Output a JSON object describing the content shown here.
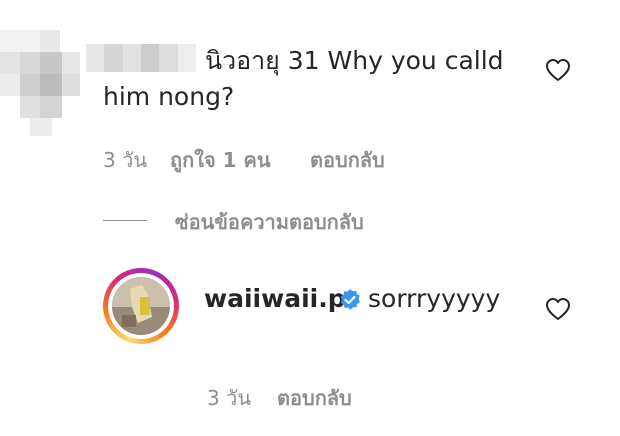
{
  "comment": {
    "text_line1": "นิวอายุ 31 Why you calld",
    "text_line2": "him nong?",
    "time": "3 วัน",
    "likes": "ถูกใจ 1 คน",
    "reply_label": "ตอบกลับ",
    "like_icon": "heart-icon"
  },
  "thread": {
    "hide_replies_label": "ซ่อนข้อความตอบกลับ"
  },
  "reply": {
    "username": "waiiwaii.p",
    "verified_icon": "verified-badge-icon",
    "text": "sorrryyyyy",
    "time": "3 วัน",
    "reply_label": "ตอบกลับ",
    "like_icon": "heart-icon"
  },
  "colors": {
    "text": "#262626",
    "secondary": "#8e8e8e",
    "verified": "#3897f0"
  }
}
